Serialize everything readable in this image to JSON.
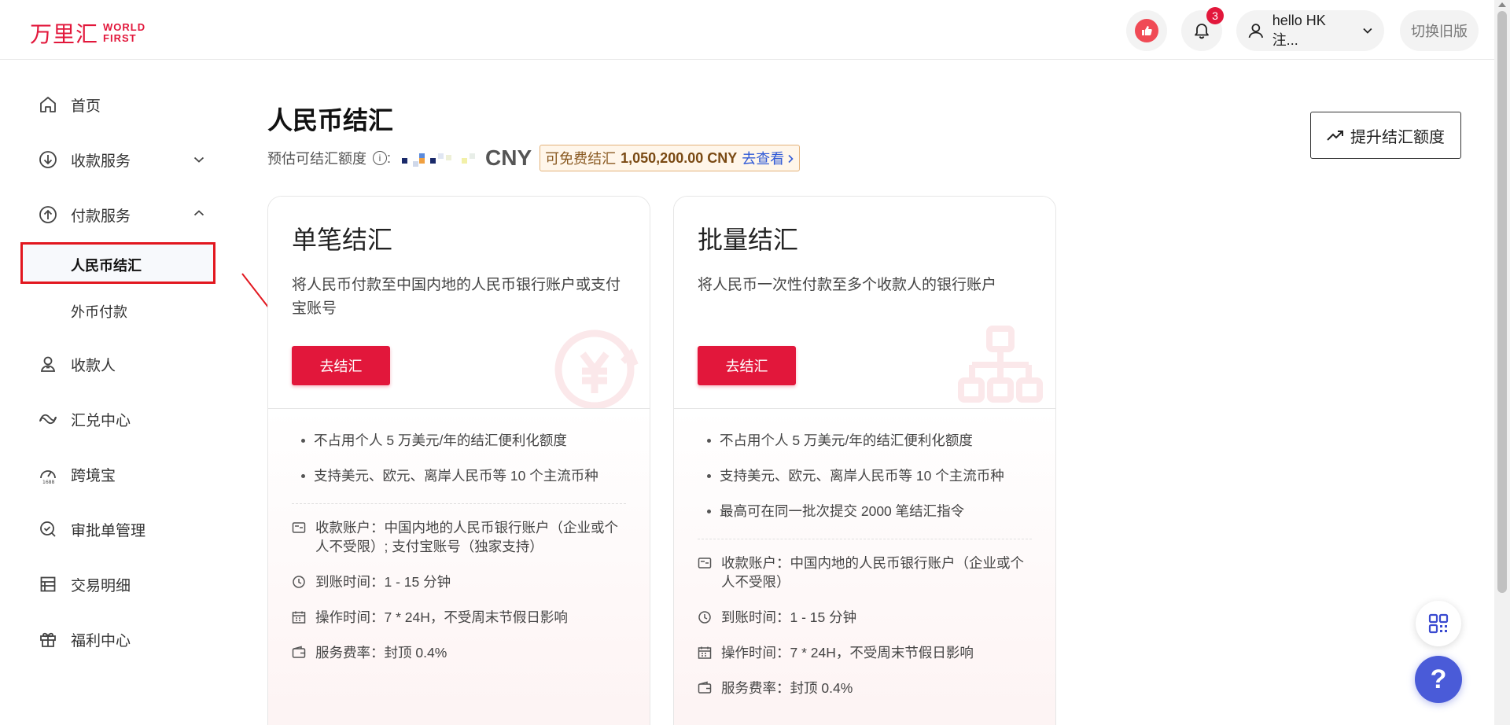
{
  "header": {
    "logo_cn": "万里汇",
    "logo_en_line1": "WORLD",
    "logo_en_line2": "FIRST",
    "notification_count": "3",
    "user_name": "hello HK 注...",
    "switch_old_label": "切换旧版"
  },
  "sidebar": {
    "home": "首页",
    "collection": "收款服务",
    "payment": "付款服务",
    "payment_sub_rmb": "人民币结汇",
    "payment_sub_foreign": "外币付款",
    "payee": "收款人",
    "exchange": "汇兑中心",
    "kuajingbao": "跨境宝",
    "kuajingbao_icon_label": "1688",
    "approval": "审批单管理",
    "transactions": "交易明细",
    "benefits": "福利中心"
  },
  "main": {
    "title": "人民币结汇",
    "quota_label": "预估可结汇额度",
    "quota_colon": ":",
    "currency": "CNY",
    "free_tag_label": "可免费结汇",
    "free_tag_amount": "1,050,200.00 CNY",
    "free_tag_link": "去查看",
    "raise_button": "提升结汇额度"
  },
  "cards": {
    "single": {
      "title": "单笔结汇",
      "desc": "将人民币付款至中国内地的人民币银行账户或支付宝账号",
      "button": "去结汇",
      "bullets": [
        "不占用个人 5 万美元/年的结汇便利化额度",
        "支持美元、欧元、离岸人民币等 10 个主流币种"
      ],
      "features": [
        "收款账户：中国内地的人民币银行账户（企业或个人不受限）; 支付宝账号（独家支持）",
        "到账时间：1 - 15 分钟",
        "操作时间：7 * 24H，不受周末节假日影响",
        "服务费率：封顶 0.4%"
      ]
    },
    "batch": {
      "title": "批量结汇",
      "desc": "将人民币一次性付款至多个收款人的银行账户",
      "button": "去结汇",
      "bullets": [
        "不占用个人 5 万美元/年的结汇便利化额度",
        "支持美元、欧元、离岸人民币等 10 个主流币种",
        "最高可在同一批次提交 2000 笔结汇指令"
      ],
      "features": [
        "收款账户：中国内地的人民币银行账户（企业或个人不受限）",
        "到账时间：1 - 15 分钟",
        "操作时间：7 * 24H，不受周末节假日影响",
        "服务费率：封顶 0.4%"
      ]
    }
  },
  "colors": {
    "brand_red": "#e2173b",
    "help_blue": "#4a5bd8",
    "link_blue": "#2f59d6",
    "highlight_box": "#e2171f"
  },
  "icons": {
    "help": "?"
  }
}
